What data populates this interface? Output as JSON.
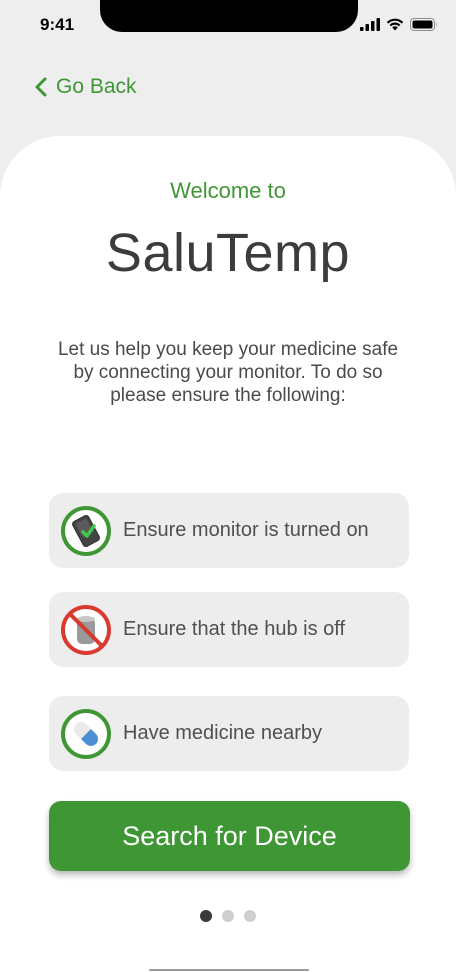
{
  "status_bar": {
    "time": "9:41",
    "icons": [
      "cellular-signal-icon",
      "wifi-icon",
      "battery-icon"
    ]
  },
  "nav": {
    "back_label": "Go Back",
    "back_icon": "chevron-left-icon"
  },
  "header": {
    "welcome": "Welcome to",
    "app_name": "SaluTemp"
  },
  "intro_text": "Let us help you keep your medicine safe by connecting your monitor. To do so please ensure the following:",
  "requirements": [
    {
      "label": "Ensure monitor is turned on",
      "icon": "monitor-on-icon"
    },
    {
      "label": "Ensure that the hub is off",
      "icon": "hub-off-icon"
    },
    {
      "label": "Have medicine nearby",
      "icon": "medicine-icon"
    }
  ],
  "primary_action": {
    "label": "Search for Device"
  },
  "pagination": {
    "current": 1,
    "total": 3
  },
  "colors": {
    "accent": "#3e9734",
    "prohibit": "#d93a2f",
    "card_bg": "#ededee",
    "page_bg": "#eeeeef"
  }
}
